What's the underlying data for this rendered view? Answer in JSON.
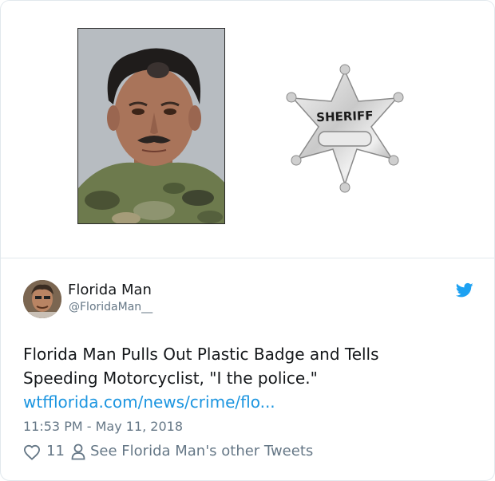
{
  "media": {
    "images": [
      "mugshot-photo",
      "sheriff-badge"
    ],
    "badge_text": "SHERIFF"
  },
  "author": {
    "name": "Florida Man",
    "handle": "@FloridaMan__"
  },
  "tweet": {
    "line1": "Florida Man Pulls Out Plastic Badge and Tells",
    "line2": "Speeding Motorcyclist, \"I the police.\"",
    "link": "wtfflorida.com/news/crime/flo..."
  },
  "meta": {
    "timestamp": "11:53 PM - May 11, 2018",
    "likes": "11",
    "other_tweets": "See Florida Man's other Tweets"
  },
  "colors": {
    "link": "#1b95e0",
    "secondary_text": "#657786",
    "twitter_blue": "#1da1f2"
  }
}
